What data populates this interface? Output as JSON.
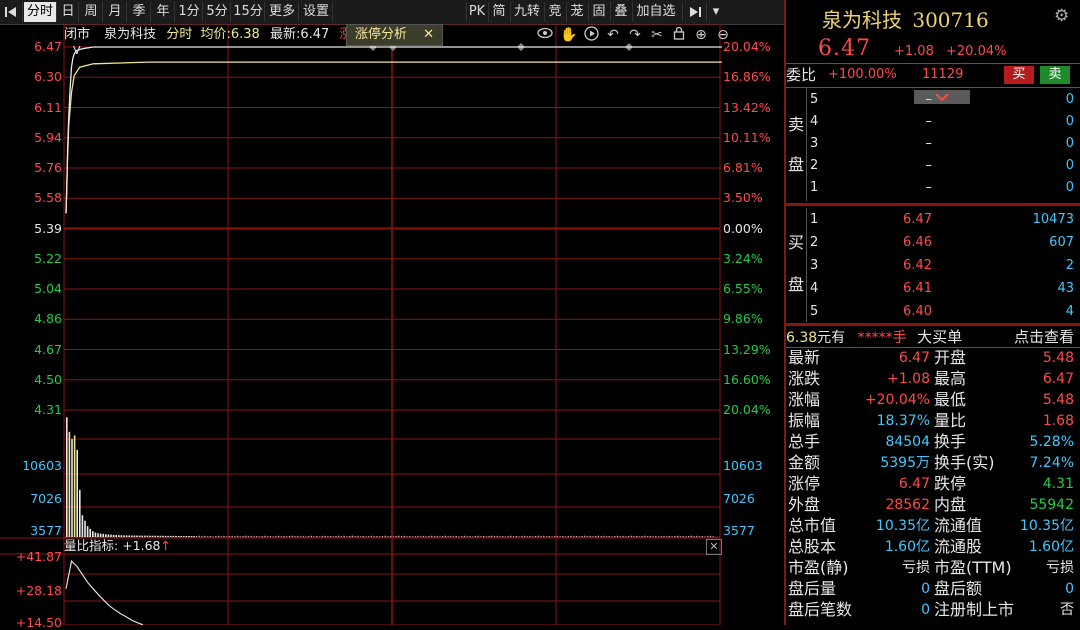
{
  "toolbar": {
    "periods": [
      "分时",
      "日",
      "周",
      "月",
      "季",
      "年",
      "1分",
      "5分",
      "15分",
      "更多",
      "设置"
    ],
    "active_period": "分时",
    "tools": [
      "PK",
      "简",
      "九转",
      "竞",
      "茏",
      "固",
      "叠",
      "加自选"
    ]
  },
  "chart_header": {
    "status": "闭市",
    "stock_name": "泉为科技",
    "mode": "分时",
    "avg_label": "均价:",
    "avg_value": "6.38",
    "last_label": "最新:",
    "last_value": "6.47",
    "limit_tag": "涨",
    "tab_label": "涨停分析",
    "tab_close": "✕",
    "marker": "V"
  },
  "chart_data": {
    "type": "line",
    "title": "",
    "prev_close": 5.39,
    "limit_up_price": 6.47,
    "price_ticks": [
      "6.47",
      "6.30",
      "6.11",
      "5.94",
      "5.76",
      "5.58",
      "5.39",
      "5.22",
      "5.04",
      "4.86",
      "4.67",
      "4.50",
      "4.31"
    ],
    "pct_ticks": [
      "20.04%",
      "16.86%",
      "13.42%",
      "10.11%",
      "6.81%",
      "3.50%",
      "0.00%",
      "3.24%",
      "6.55%",
      "9.86%",
      "13.29%",
      "16.60%",
      "20.04%"
    ],
    "ylim": [
      4.31,
      6.47
    ],
    "price_series": {
      "name": "",
      "x": [
        0,
        0.3,
        0.6,
        1,
        1.5,
        2,
        2.5,
        3,
        4,
        6,
        10,
        20,
        40,
        80,
        120,
        160,
        200,
        240
      ],
      "values": [
        5.48,
        5.62,
        5.86,
        6.05,
        6.22,
        6.35,
        6.4,
        6.43,
        6.45,
        6.46,
        6.47,
        6.47,
        6.47,
        6.47,
        6.47,
        6.47,
        6.47,
        6.47
      ]
    },
    "avg_series": {
      "name": "",
      "x": [
        0,
        0.5,
        1,
        2,
        3,
        5,
        10,
        30,
        60,
        120,
        240
      ],
      "values": [
        5.48,
        5.78,
        6.0,
        6.2,
        6.3,
        6.35,
        6.37,
        6.38,
        6.38,
        6.38,
        6.38
      ]
    },
    "volume_ticks": [
      "10603",
      "7026",
      "3577"
    ],
    "volume_ylim": [
      0,
      14000
    ],
    "volume_bars": [
      13200,
      11600,
      10800,
      11200,
      9600,
      5200,
      2400,
      1800,
      1200,
      900,
      650,
      500,
      420,
      380,
      350,
      300,
      280,
      260,
      240,
      220,
      210,
      200,
      190,
      180,
      175,
      170,
      165,
      160,
      155,
      150,
      150,
      150,
      145,
      140,
      140,
      135,
      130,
      130,
      125,
      125,
      120,
      120,
      118,
      116,
      114,
      112,
      110,
      110,
      108,
      106
    ],
    "vr_ticks": [
      "+41.87",
      "+28.18",
      "+14.50"
    ],
    "vr_ylim": [
      14.5,
      41.87
    ],
    "vr_series": {
      "name": "",
      "x": [
        0,
        1,
        2,
        3,
        4,
        5,
        6,
        7,
        8,
        9,
        10,
        11,
        12,
        13,
        14
      ],
      "values": [
        30,
        41.8,
        39.5,
        36,
        32.5,
        29.8,
        27.2,
        24.8,
        22.5,
        20.8,
        19.2,
        17.9,
        16.5,
        15.5,
        14.6
      ]
    },
    "vr_label": "量比指标:",
    "vr_value": "+1.68",
    "vr_arrow": "↑"
  },
  "quote": {
    "name": "泉为科技",
    "code": "300716",
    "price": "6.47",
    "change": "+1.08",
    "change_pct": "+20.04%",
    "wb_label": "委比",
    "wb_value": "+100.00%",
    "wb_count": "11129",
    "buy_btn": "买",
    "sell_btn": "卖",
    "sell_side_label": [
      "卖",
      "盘"
    ],
    "buy_side_label": [
      "买",
      "盘"
    ],
    "sell_book": [
      {
        "level": "5",
        "price": "–",
        "vol": "0"
      },
      {
        "level": "4",
        "price": "–",
        "vol": "0"
      },
      {
        "level": "3",
        "price": "–",
        "vol": "0"
      },
      {
        "level": "2",
        "price": "–",
        "vol": "0"
      },
      {
        "level": "1",
        "price": "–",
        "vol": "0"
      }
    ],
    "buy_book": [
      {
        "level": "1",
        "price": "6.47",
        "vol": "10473"
      },
      {
        "level": "2",
        "price": "6.46",
        "vol": "607"
      },
      {
        "level": "3",
        "price": "6.42",
        "vol": "2"
      },
      {
        "level": "4",
        "price": "6.41",
        "vol": "43"
      },
      {
        "level": "5",
        "price": "6.40",
        "vol": "4"
      }
    ],
    "bigbuy": {
      "price": "6.38",
      "unit1": "元有",
      "stars": "*****",
      "unit2": "手",
      "title": "大买单",
      "link": "点击查看"
    },
    "stats": [
      [
        "最新",
        "6.47",
        "red",
        "开盘",
        "5.48",
        "red"
      ],
      [
        "涨跌",
        "+1.08",
        "red",
        "最高",
        "6.47",
        "red"
      ],
      [
        "涨幅",
        "+20.04%",
        "red",
        "最低",
        "5.48",
        "red"
      ],
      [
        "振幅",
        "18.37%",
        "cyan",
        "量比",
        "1.68",
        "red"
      ],
      [
        "总手",
        "84504",
        "cyan",
        "换手",
        "5.28%",
        "cyan"
      ],
      [
        "金额",
        "5395万",
        "cyan",
        "换手(实)",
        "7.24%",
        "cyan"
      ],
      [
        "涨停",
        "6.47",
        "red",
        "跌停",
        "4.31",
        "green"
      ],
      [
        "外盘",
        "28562",
        "red",
        "内盘",
        "55942",
        "green"
      ],
      [
        "总市值",
        "10.35亿",
        "cyan",
        "流通值",
        "10.35亿",
        "cyan"
      ],
      [
        "总股本",
        "1.60亿",
        "cyan",
        "流通股",
        "1.60亿",
        "cyan"
      ],
      [
        "市盈(静)",
        "亏损",
        "white",
        "市盈(TTM)",
        "亏损",
        "white"
      ],
      [
        "盘后量",
        "0",
        "cyan",
        "盘后额",
        "0",
        "cyan"
      ],
      [
        "盘后笔数",
        "0",
        "cyan",
        "注册制上市",
        "否",
        "white"
      ]
    ]
  },
  "colors": {
    "up": "#ff4a4a",
    "down": "#22cc44",
    "neutral": "#e6e6e6",
    "grid": "#8a1515",
    "price_line": "#e8e8e8",
    "avg_line": "#f0e68c",
    "accent_title": "#f0d36a"
  }
}
